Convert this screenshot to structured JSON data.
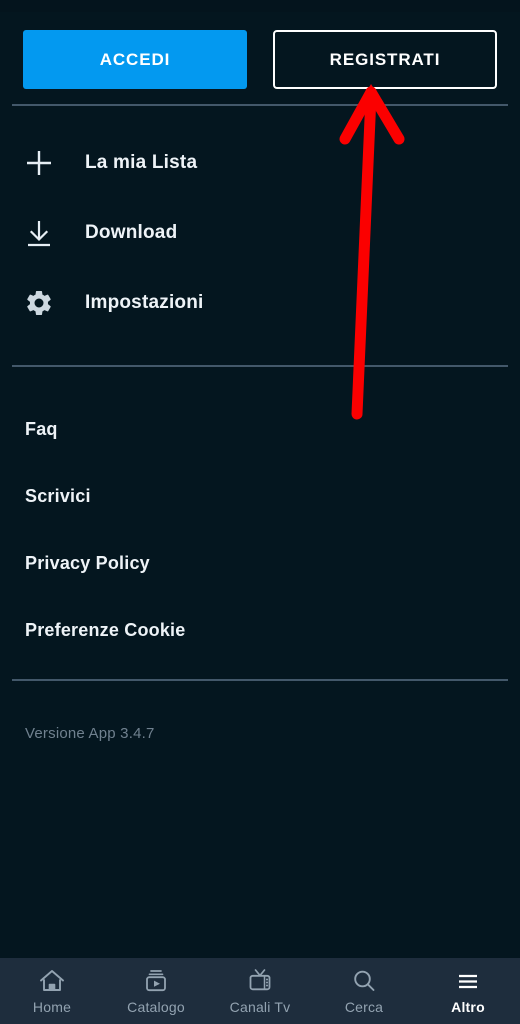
{
  "app": {
    "background_color": "#04161f",
    "accent_color": "#0399f0",
    "annotation_color": "#ff0000"
  },
  "auth": {
    "login_label": "ACCEDI",
    "register_label": "REGISTRATI"
  },
  "menu": {
    "items": [
      {
        "label": "La mia Lista",
        "icon": "plus-icon"
      },
      {
        "label": "Download",
        "icon": "download-icon"
      },
      {
        "label": "Impostazioni",
        "icon": "gear-icon"
      }
    ]
  },
  "links": {
    "items": [
      {
        "label": "Faq"
      },
      {
        "label": "Scrivici"
      },
      {
        "label": "Privacy Policy"
      },
      {
        "label": "Preferenze Cookie"
      }
    ]
  },
  "footer": {
    "version": "Versione App 3.4.7"
  },
  "bottom_nav": {
    "items": [
      {
        "label": "Home",
        "icon": "home-icon",
        "active": false
      },
      {
        "label": "Catalogo",
        "icon": "catalog-stack-play-icon",
        "active": false
      },
      {
        "label": "Canali Tv",
        "icon": "tv-icon",
        "active": false
      },
      {
        "label": "Cerca",
        "icon": "search-icon",
        "active": false
      },
      {
        "label": "Altro",
        "icon": "hamburger-menu-icon",
        "active": true
      }
    ]
  },
  "annotation": {
    "type": "arrow",
    "points_to": "REGISTRATI",
    "color": "#ff0000"
  }
}
